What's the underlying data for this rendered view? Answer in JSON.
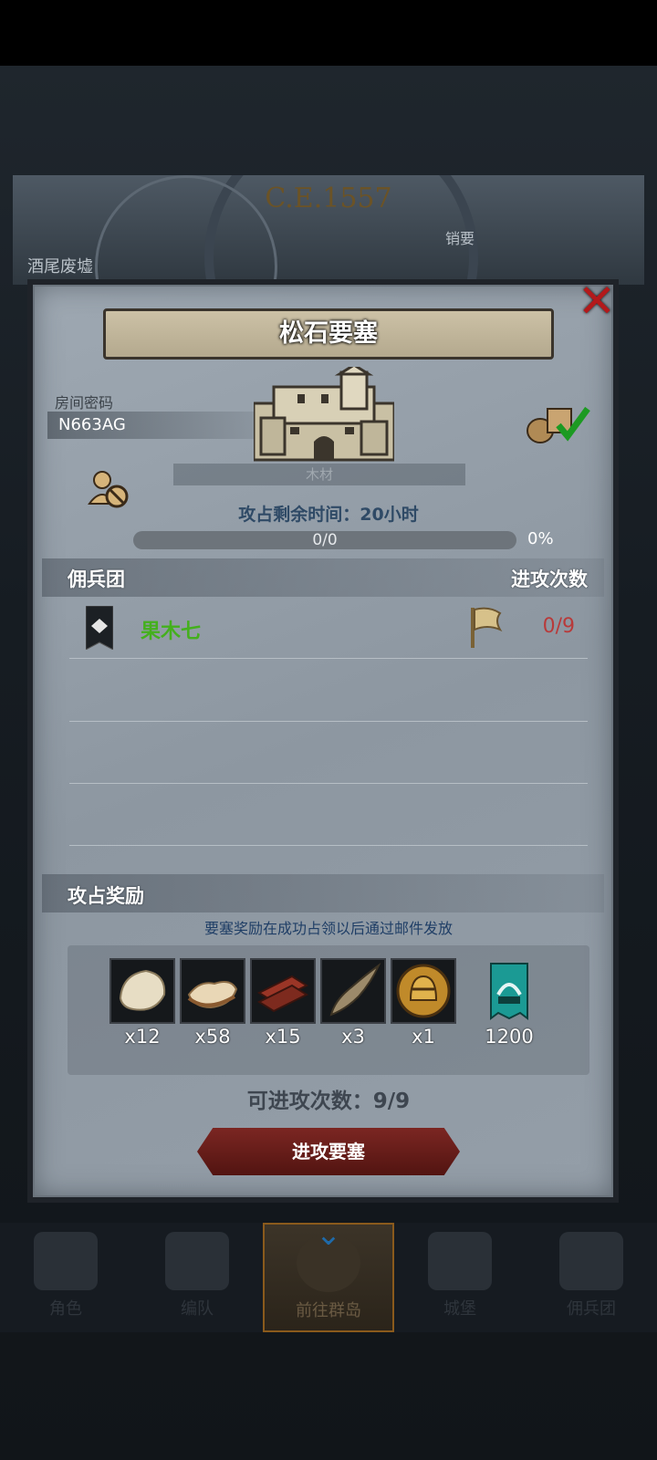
{
  "map": {
    "era": "C.E.1557",
    "region_left": "酒尾废墟",
    "region_right": "销要"
  },
  "fortress": {
    "title": "松石要塞",
    "room_label": "房间密码",
    "room_code": "N663AG",
    "resource_hint": "木材",
    "remaining_time": "攻占剩余时间：20小时",
    "progress_text": "0/0",
    "progress_percent": "0%",
    "progress_fraction": 0
  },
  "mercenary": {
    "header_left": "佣兵团",
    "header_right": "进攻次数",
    "rows": [
      {
        "name": "果木七",
        "attacks": "0/9"
      }
    ]
  },
  "rewards": {
    "header": "攻占奖励",
    "note": "要塞奖励在成功占领以后通过邮件发放",
    "items": [
      {
        "icon": "fur-pelt-icon",
        "qty": "x12"
      },
      {
        "icon": "leather-hide-icon",
        "qty": "x58"
      },
      {
        "icon": "wood-planks-icon",
        "qty": "x15"
      },
      {
        "icon": "horn-icon",
        "qty": "x3"
      },
      {
        "icon": "knight-helmet-coin-icon",
        "qty": "x1"
      },
      {
        "icon": "castle-banner-icon",
        "qty": "1200"
      }
    ]
  },
  "attacks_available": "可进攻次数：9/9",
  "attack_button": "进攻要塞",
  "nav": [
    {
      "label": "角色",
      "icon": "knight-icon"
    },
    {
      "label": "编队",
      "icon": "helmet-icon"
    },
    {
      "label": "前往群岛",
      "icon": "compass-icon"
    },
    {
      "label": "城堡",
      "icon": "castle-icon"
    },
    {
      "label": "佣兵团",
      "icon": "mercenary-icon"
    }
  ],
  "colors": {
    "accent_green": "#44b01d",
    "count_red": "#b83a3a",
    "button_red": "#7b2622"
  }
}
